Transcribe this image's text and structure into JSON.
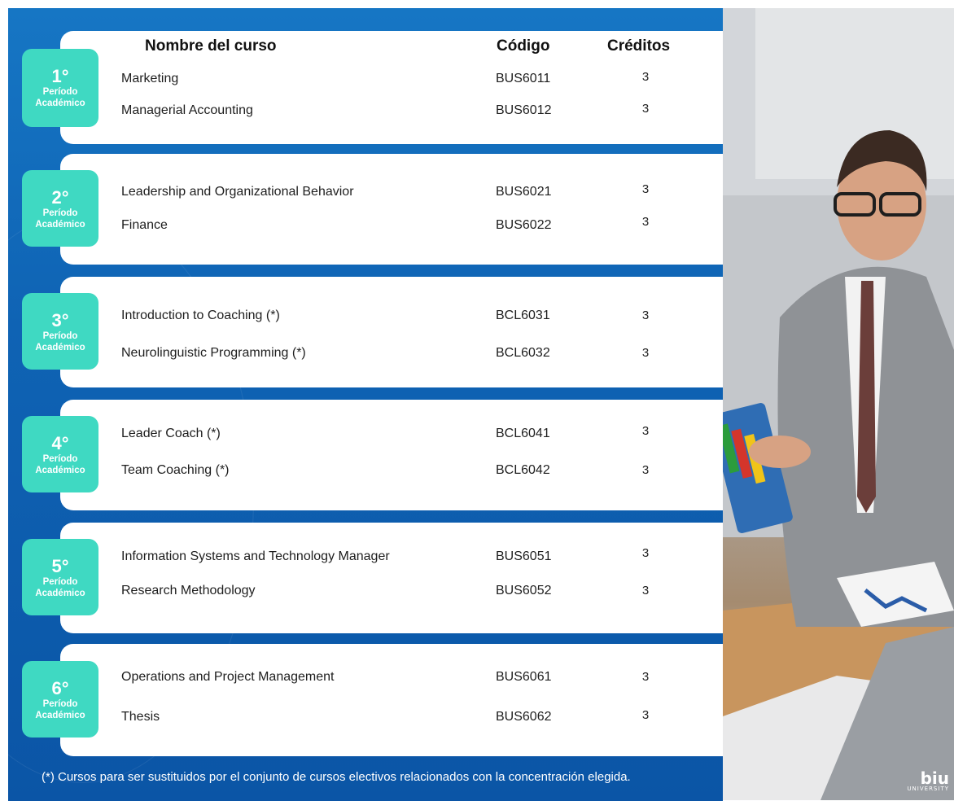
{
  "headers": {
    "course": "Nombre del curso",
    "code": "Código",
    "credits": "Créditos"
  },
  "periods": [
    {
      "num": "1°",
      "label1": "Período",
      "label2": "Académico",
      "courses": [
        {
          "name": "Marketing",
          "code": "BUS6011",
          "credits": "3"
        },
        {
          "name": "Managerial Accounting",
          "code": "BUS6012",
          "credits": "3"
        }
      ]
    },
    {
      "num": "2°",
      "label1": "Período",
      "label2": "Académico",
      "courses": [
        {
          "name": "Leadership and Organizational Behavior",
          "code": "BUS6021",
          "credits": "3"
        },
        {
          "name": "Finance",
          "code": "BUS6022",
          "credits": "3"
        }
      ]
    },
    {
      "num": "3°",
      "label1": "Período",
      "label2": "Académico",
      "courses": [
        {
          "name": "Introduction to Coaching (*)",
          "code": "BCL6031",
          "credits": "3"
        },
        {
          "name": "Neurolinguistic Programming (*)",
          "code": "BCL6032",
          "credits": "3"
        }
      ]
    },
    {
      "num": "4°",
      "label1": "Período",
      "label2": "Académico",
      "courses": [
        {
          "name": "Leader Coach (*)",
          "code": "BCL6041",
          "credits": "3"
        },
        {
          "name": "Team Coaching (*)",
          "code": "BCL6042",
          "credits": "3"
        }
      ]
    },
    {
      "num": "5°",
      "label1": "Período",
      "label2": "Académico",
      "courses": [
        {
          "name": "Information Systems and Technology Manager",
          "code": "BUS6051",
          "credits": "3"
        },
        {
          "name": "Research Methodology",
          "code": "BUS6052",
          "credits": "3"
        }
      ]
    },
    {
      "num": "6°",
      "label1": "Período",
      "label2": "Académico",
      "courses": [
        {
          "name": "Operations and Project Management",
          "code": "BUS6061",
          "credits": "3"
        },
        {
          "name": "Thesis",
          "code": "BUS6062",
          "credits": "3"
        }
      ]
    }
  ],
  "footnote": "(*) Cursos para ser sustituidos por el conjunto de cursos electivos relacionados con la concentración elegida.",
  "logo": {
    "main": "biu",
    "sub": "UNIVERSITY"
  },
  "colors": {
    "panel_blue": "#0f63b4",
    "badge_teal": "#3fd9c2",
    "card_white": "#ffffff"
  }
}
